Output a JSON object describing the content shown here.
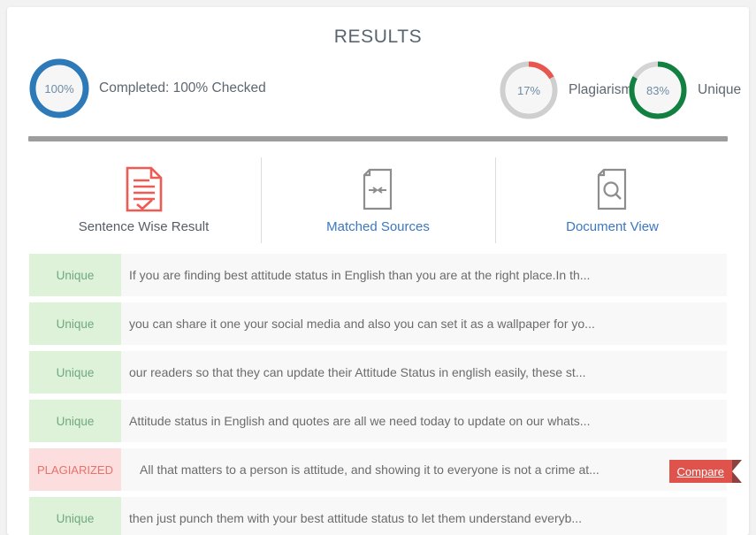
{
  "header": {
    "title": "RESULTS"
  },
  "gauges": [
    {
      "name": "completed",
      "value": 100,
      "value_label": "100%",
      "label": "Completed: 100% Checked",
      "color": "#2e7ab8",
      "track_color": "#e4e4e4",
      "fill_color": "#f6f6f6"
    },
    {
      "name": "plagiarism",
      "value": 17,
      "value_label": "17%",
      "label": "Plagiarism",
      "color": "#e8564f",
      "track_color": "#cfcfcf",
      "fill_color": "#f6f6f6"
    },
    {
      "name": "unique",
      "value": 83,
      "value_label": "83%",
      "label": "Unique",
      "color": "#118040",
      "track_color": "#d4d4d4",
      "fill_color": "#f6f6f6"
    }
  ],
  "tabs": [
    {
      "id": "sentence-wise-result",
      "label": "Sentence Wise Result",
      "icon": "document-check-icon",
      "active": true,
      "icon_color": "#ef5a52"
    },
    {
      "id": "matched-sources",
      "label": "Matched Sources",
      "icon": "document-arrows-icon",
      "active": false,
      "icon_color": "#8d8d8d"
    },
    {
      "id": "document-view",
      "label": "Document View",
      "icon": "document-search-icon",
      "active": false,
      "icon_color": "#8d8d8d"
    }
  ],
  "results": {
    "rows": [
      {
        "status": "Unique",
        "status_type": "unique",
        "text": "If you are finding best attitude status in English than you are at the right place.In th...",
        "has_compare": false
      },
      {
        "status": "Unique",
        "status_type": "unique",
        "text": "you can share it one your social media and also you can set it as a wallpaper for yo...",
        "has_compare": false
      },
      {
        "status": "Unique",
        "status_type": "unique",
        "text": "our readers so that they can update their Attitude Status in english easily, these st...",
        "has_compare": false
      },
      {
        "status": "Unique",
        "status_type": "unique",
        "text": "Attitude status in English and quotes are all we need today to update on our whats...",
        "has_compare": false
      },
      {
        "status": "PLAGIARIZED",
        "status_type": "plagiarized",
        "text": "All that matters to a person is attitude, and showing it to everyone is not a crime at...",
        "has_compare": true,
        "compare_label": "Compare"
      },
      {
        "status": "Unique",
        "status_type": "unique",
        "text": "then just punch them with your best attitude status to let them understand everyb...",
        "has_compare": false
      }
    ]
  }
}
